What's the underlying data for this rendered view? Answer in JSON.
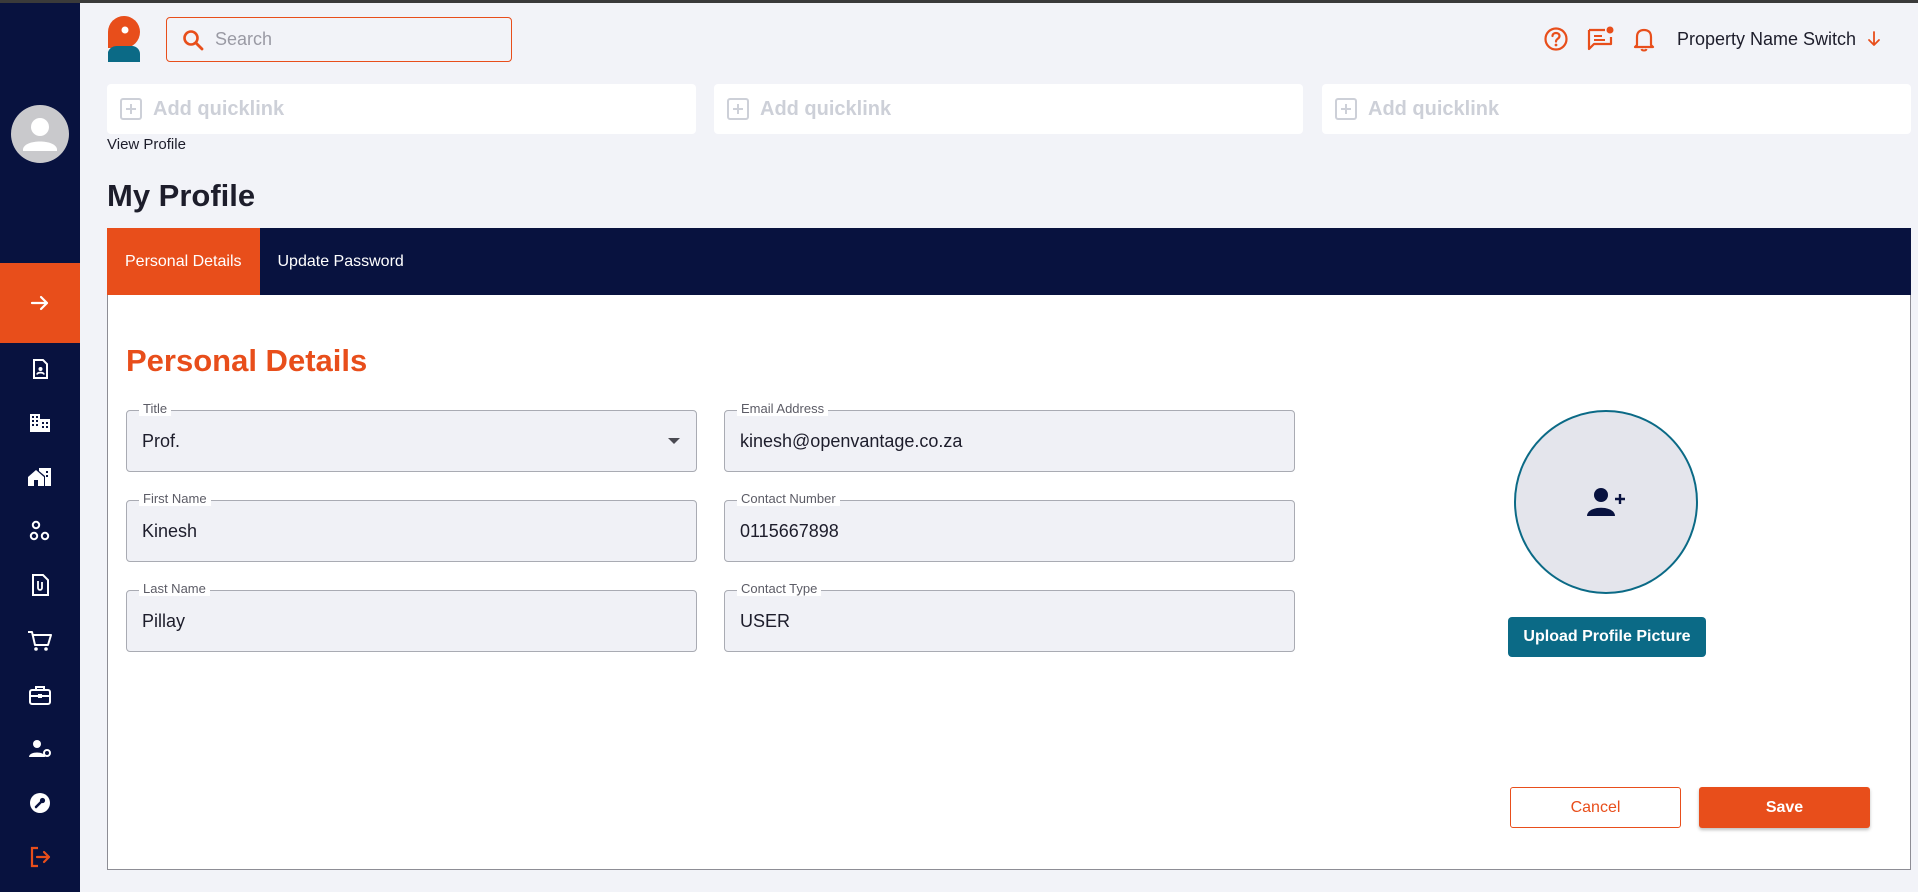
{
  "colors": {
    "sidebar_bg": "#08123f",
    "accent": "#e84e1b",
    "teal": "#0b6a86",
    "page_bg": "#f2f3f8"
  },
  "header": {
    "search": {
      "placeholder": "Search",
      "value": ""
    },
    "icons": [
      "help-circle-icon",
      "chat-notification-icon",
      "bell-icon"
    ],
    "property_switch": {
      "label": "Property Name Switch",
      "icon": "arrow-down-icon"
    }
  },
  "quicklinks": [
    {
      "label": "Add quicklink",
      "icon": "plus-square-icon"
    },
    {
      "label": "Add quicklink",
      "icon": "plus-square-icon"
    },
    {
      "label": "Add quicklink",
      "icon": "plus-square-icon"
    }
  ],
  "sidebar": {
    "avatar_icon": "user-avatar-icon",
    "expand_icon": "arrow-right-icon",
    "items": [
      {
        "icon": "contact-card-icon"
      },
      {
        "icon": "building-icon"
      },
      {
        "icon": "property-icon"
      },
      {
        "icon": "hierarchy-icon"
      },
      {
        "icon": "attachment-file-icon"
      },
      {
        "icon": "cart-icon"
      },
      {
        "icon": "briefcase-icon"
      },
      {
        "icon": "user-settings-icon"
      },
      {
        "icon": "wrench-icon"
      },
      {
        "icon": "logout-icon"
      }
    ]
  },
  "breadcrumb": "View Profile",
  "page_title": "My Profile",
  "tabs": [
    {
      "label": "Personal Details",
      "active": true
    },
    {
      "label": "Update Password",
      "active": false
    }
  ],
  "form": {
    "section_title": "Personal Details",
    "title": {
      "label": "Title",
      "value": "Prof."
    },
    "first_name": {
      "label": "First Name",
      "value": "Kinesh"
    },
    "last_name": {
      "label": "Last Name",
      "value": "Pillay"
    },
    "email": {
      "label": "Email Address",
      "value": "kinesh@openvantage.co.za"
    },
    "contact_number": {
      "label": "Contact Number",
      "value": "0115667898"
    },
    "contact_type": {
      "label": "Contact Type",
      "value": "USER"
    }
  },
  "profile_picture": {
    "icon": "add-user-icon",
    "upload_label": "Upload Profile Picture"
  },
  "actions": {
    "cancel_label": "Cancel",
    "save_label": "Save"
  }
}
